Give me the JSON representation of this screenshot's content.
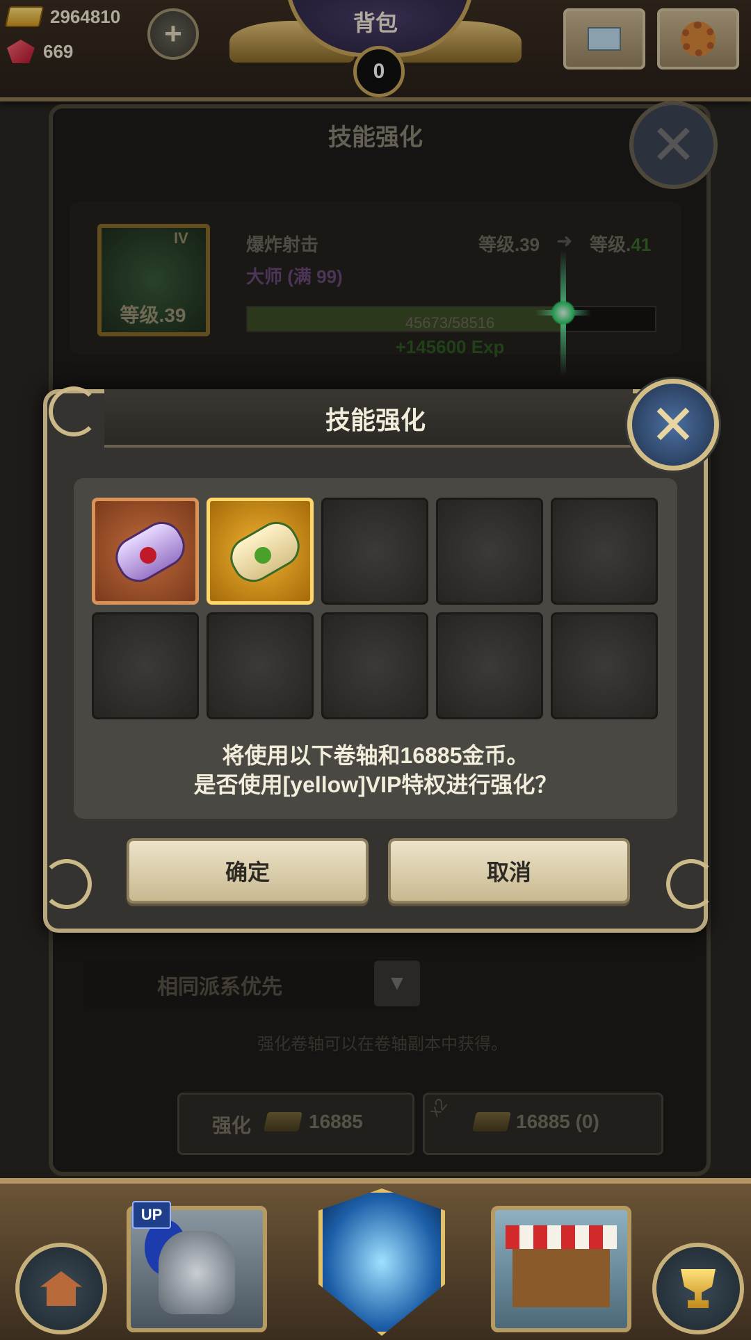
{
  "currency": {
    "gold": "2964810",
    "gems": "669"
  },
  "header": {
    "title": "背包",
    "badge_count": "0"
  },
  "skill_panel": {
    "title": "技能强化",
    "skill_name": "爆炸射击",
    "rank": "大师 (满 99)",
    "icon_roman": "IV",
    "icon_level": "等级.39",
    "level_from": "等级.39",
    "level_to_prefix": "等级.",
    "level_to_value": "41",
    "exp_text": "45673/58516",
    "exp_progress": 0.78,
    "exp_gain": "+145600 Exp",
    "sort_label": "相同派系优先",
    "hint": "强化卷轴可以在卷轴副本中获得。",
    "upgrade_label": "强化",
    "upgrade_cost": "16885",
    "vip_multiplier": "x2",
    "vip_cost": "16885 (0)"
  },
  "modal": {
    "title": "技能强化",
    "slots": [
      {
        "kind": "purple-scroll"
      },
      {
        "kind": "green-scroll"
      },
      {
        "kind": "empty"
      },
      {
        "kind": "empty"
      },
      {
        "kind": "empty"
      },
      {
        "kind": "empty"
      },
      {
        "kind": "empty"
      },
      {
        "kind": "empty"
      },
      {
        "kind": "empty"
      },
      {
        "kind": "empty"
      }
    ],
    "message_line1": "将使用以下卷轴和16885金币。",
    "message_line2": "是否使用[yellow]VIP特权进行强化？",
    "confirm": "确定",
    "cancel": "取消"
  },
  "bottom_nav": {
    "up_badge": "UP"
  },
  "colors": {
    "accent_gold": "#c9a65a",
    "confirm_bg": "#ede3c8",
    "modal_bg": "#35332f"
  },
  "icons": [
    "gold-ingot-icon",
    "ruby-icon",
    "plus-icon",
    "mail-icon",
    "gear-icon",
    "close-icon",
    "house-icon",
    "knight-helmet-icon",
    "portal-icon",
    "shop-icon",
    "trophy-icon"
  ]
}
